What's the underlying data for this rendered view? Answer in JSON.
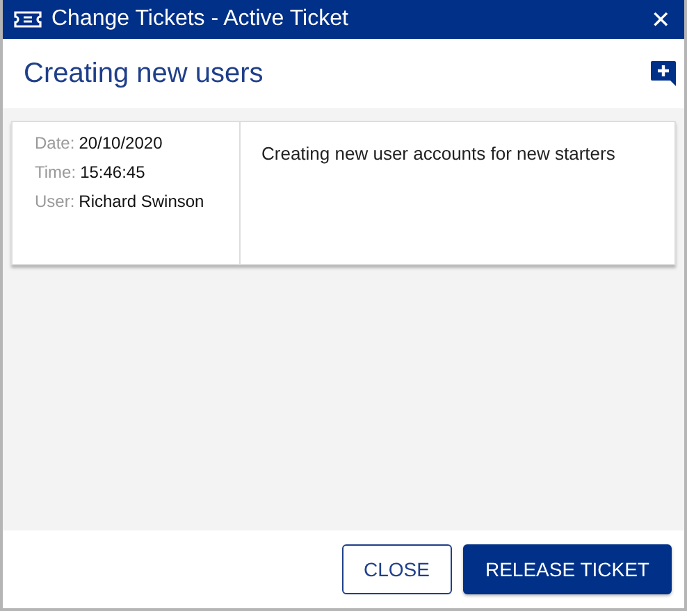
{
  "window": {
    "title": "Change Tickets - Active Ticket",
    "close": "✕"
  },
  "ticket": {
    "title": "Creating new users",
    "fields": [
      {
        "label": "Date:",
        "value": "20/10/2020"
      },
      {
        "label": "Time:",
        "value": "15:46:45"
      },
      {
        "label": "User:",
        "value": "Richard Swinson"
      }
    ],
    "description": "Creating new user accounts for new starters"
  },
  "buttons": [
    {
      "label": "CLOSE",
      "kind": "secondary"
    },
    {
      "label": "RELEASE TICKET",
      "kind": "primary"
    }
  ]
}
